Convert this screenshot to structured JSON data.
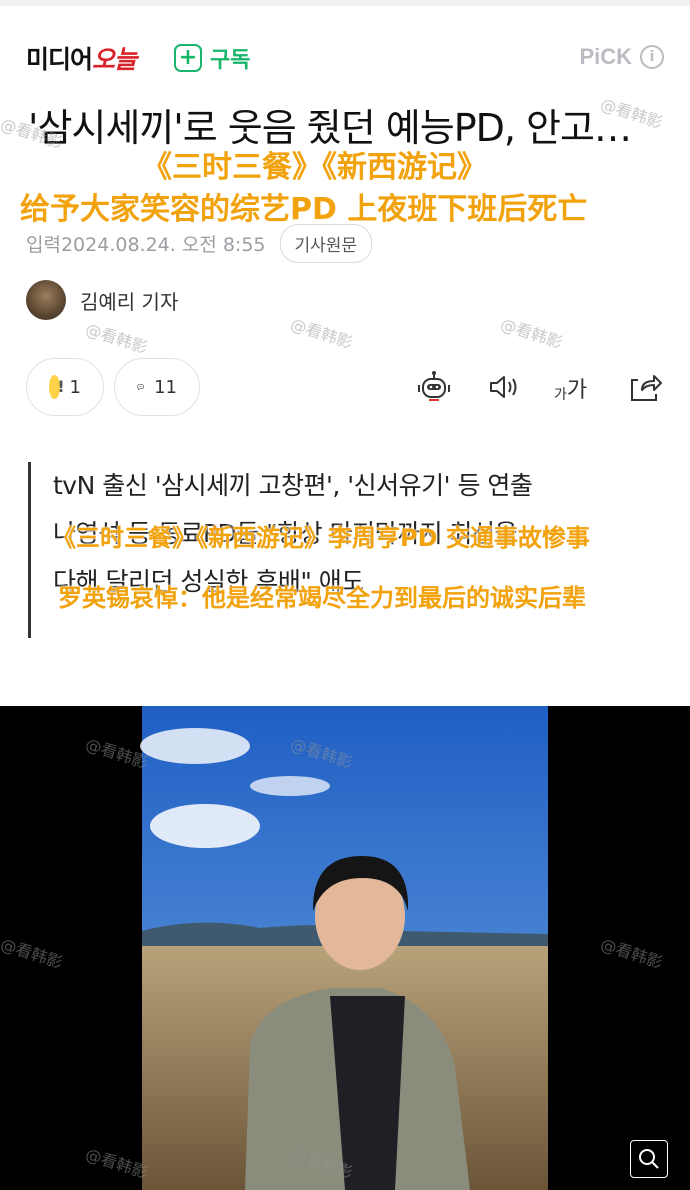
{
  "header": {
    "logo_prefix": "미디어",
    "logo_script": "오늘",
    "subscribe_icon": "plus-icon",
    "subscribe_label": "구독",
    "pick_label": "PiCK",
    "info_icon": "info-icon"
  },
  "article": {
    "headline_partial": "'삼시세끼'로 웃음 줬던 예능PD, 안고…",
    "date_label": "입력",
    "date_value": "2024.08.24. 오전 8:55",
    "source_button": "기사원문",
    "author": "김예리 기자",
    "summary_lines": [
      "tvN 출신 '삼시세끼 고창편', '신서유기' 등 연출",
      "",
      "나영석 등 동료PD들 \"항상 마지막까지 최선을",
      "다해 달리던 성실한 후배\" 애도"
    ]
  },
  "overlay_captions": {
    "line1": "《三时三餐》《新西游记》",
    "line2": "给予大家笑容的综艺PD 上夜班下班后死亡",
    "line3": "《三时三餐》《新西游记》李周亨PD 交通事故惨事",
    "line4": "罗英锡哀悼：他是经常竭尽全力到最后的诚实后辈"
  },
  "actions": {
    "reaction_icon": "exclamation-reaction-icon",
    "reaction_count": "1",
    "comment_icon": "comment-icon",
    "comment_count": "11",
    "toolbar_icons": [
      "robot-summary-icon",
      "speaker-icon",
      "font-size-icon",
      "share-icon"
    ],
    "font_size_label_small": "가",
    "font_size_label_large": "가"
  },
  "photo": {
    "zoom_icon": "zoom-search-icon"
  },
  "watermark": "@看韩影",
  "colors": {
    "overlay_text": "#f2a20d",
    "subscribe": "#18b66b",
    "logo_accent": "#d8232a"
  }
}
